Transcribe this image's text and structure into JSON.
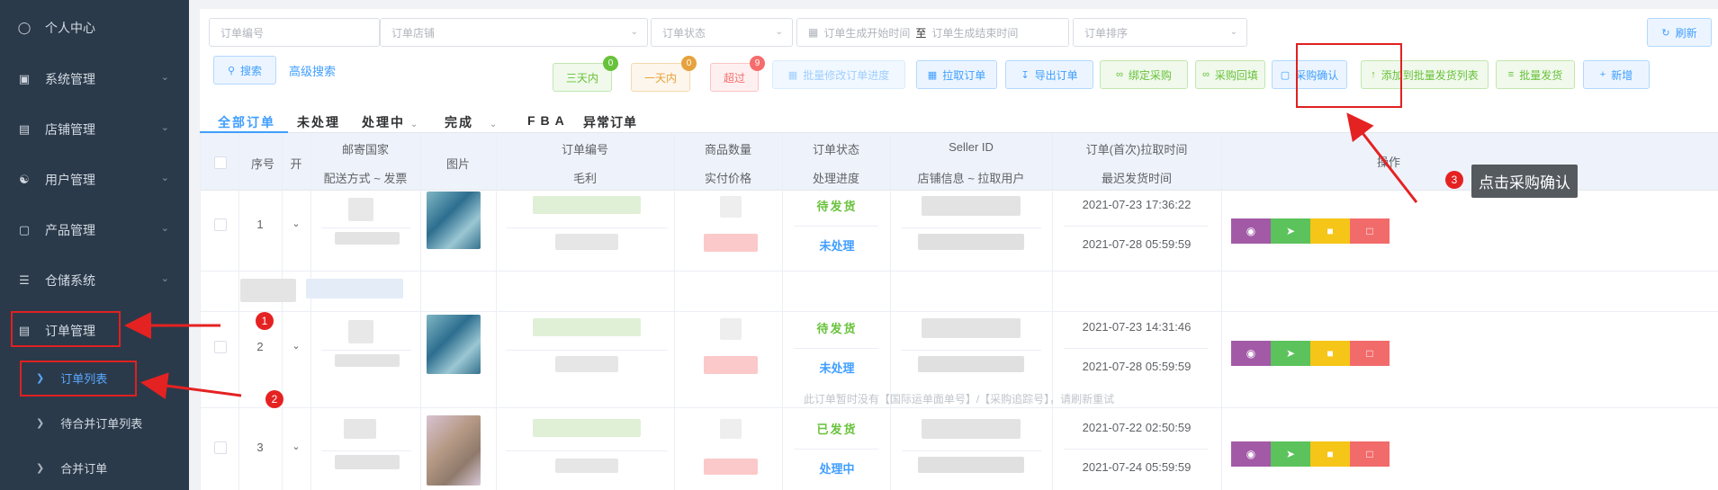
{
  "sidebar": {
    "items": [
      {
        "label": "个人中心",
        "icon": "user-icon"
      },
      {
        "label": "系统管理",
        "icon": "monitor-icon"
      },
      {
        "label": "店铺管理",
        "icon": "shop-icon"
      },
      {
        "label": "用户管理",
        "icon": "users-icon"
      },
      {
        "label": "产品管理",
        "icon": "bag-icon"
      },
      {
        "label": "仓储系统",
        "icon": "list-icon"
      },
      {
        "label": "订单管理",
        "icon": "document-icon"
      }
    ],
    "sub_items": [
      {
        "label": "订单列表",
        "active": true
      },
      {
        "label": "待合并订单列表"
      },
      {
        "label": "合并订单"
      }
    ]
  },
  "filters": {
    "order_no_placeholder": "订单编号",
    "shop_placeholder": "订单店铺",
    "status_placeholder": "订单状态",
    "start_time_placeholder": "订单生成开始时间",
    "range_sep": "至",
    "end_time_placeholder": "订单生成结束时间",
    "sort_placeholder": "订单排序",
    "refresh_label": "刷新"
  },
  "actions": {
    "search_label": "搜索",
    "advanced_label": "高级搜索",
    "three_days": {
      "label": "三天内",
      "count": "0"
    },
    "one_day": {
      "label": "一天内",
      "count": "0"
    },
    "overdue": {
      "label": "超过",
      "count": "9"
    },
    "batch_progress": "批量修改订单进度",
    "pull_orders": "拉取订单",
    "export_orders": "导出订单",
    "bind_purchase": "绑定采购",
    "purchase_backfill": "采购回填",
    "purchase_confirm": "采购确认",
    "add_batch_list": "添加到批量发货列表",
    "batch_ship": "批量发货",
    "add_new": "新增"
  },
  "tabs": [
    "全部订单",
    "未处理",
    "处理中",
    "完成",
    "FBA",
    "异常订单"
  ],
  "table": {
    "headers": {
      "index": "序号",
      "open": "开",
      "country": "邮寄国家",
      "ship_method": "配送方式 ~ 发票",
      "image": "图片",
      "order_no": "订单编号",
      "profit": "毛利",
      "qty": "商品数量",
      "paid": "实付价格",
      "order_status": "订单状态",
      "progress": "处理进度",
      "seller_id": "Seller ID",
      "store_info": "店铺信息 ~ 拉取用户",
      "pull_time": "订单(首次)拉取时间",
      "latest_ship": "最迟发货时间",
      "ops": "操作"
    },
    "rows": [
      {
        "index": "1",
        "status": "待发货",
        "progress": "未处理",
        "pull_time": "2021-07-23 17:36:22",
        "ship_time": "2021-07-28 05:59:59"
      },
      {
        "index": "2",
        "status": "待发货",
        "progress": "未处理",
        "pull_time": "2021-07-23 14:31:46",
        "ship_time": "2021-07-28 05:59:59"
      },
      {
        "index": "3",
        "status": "已发货",
        "progress": "处理中",
        "pull_time": "2021-07-22 02:50:59",
        "ship_time": "2021-07-24 05:59:59"
      }
    ],
    "row2_note": "此订单暂时没有【国际运单面单号】/【采购追踪号】，请刷新重试"
  },
  "annotations": {
    "step1": "1",
    "step2": "2",
    "step3": "3",
    "tooltip": "点击采购确认"
  },
  "colors": {
    "sidebar_bg": "#2b3a4a",
    "accent": "#409eff",
    "annotation_red": "#e02020",
    "op_purple": "#a25aa6",
    "op_green": "#5cc25c",
    "op_yellow": "#f5c518",
    "op_red": "#f26b6b"
  }
}
